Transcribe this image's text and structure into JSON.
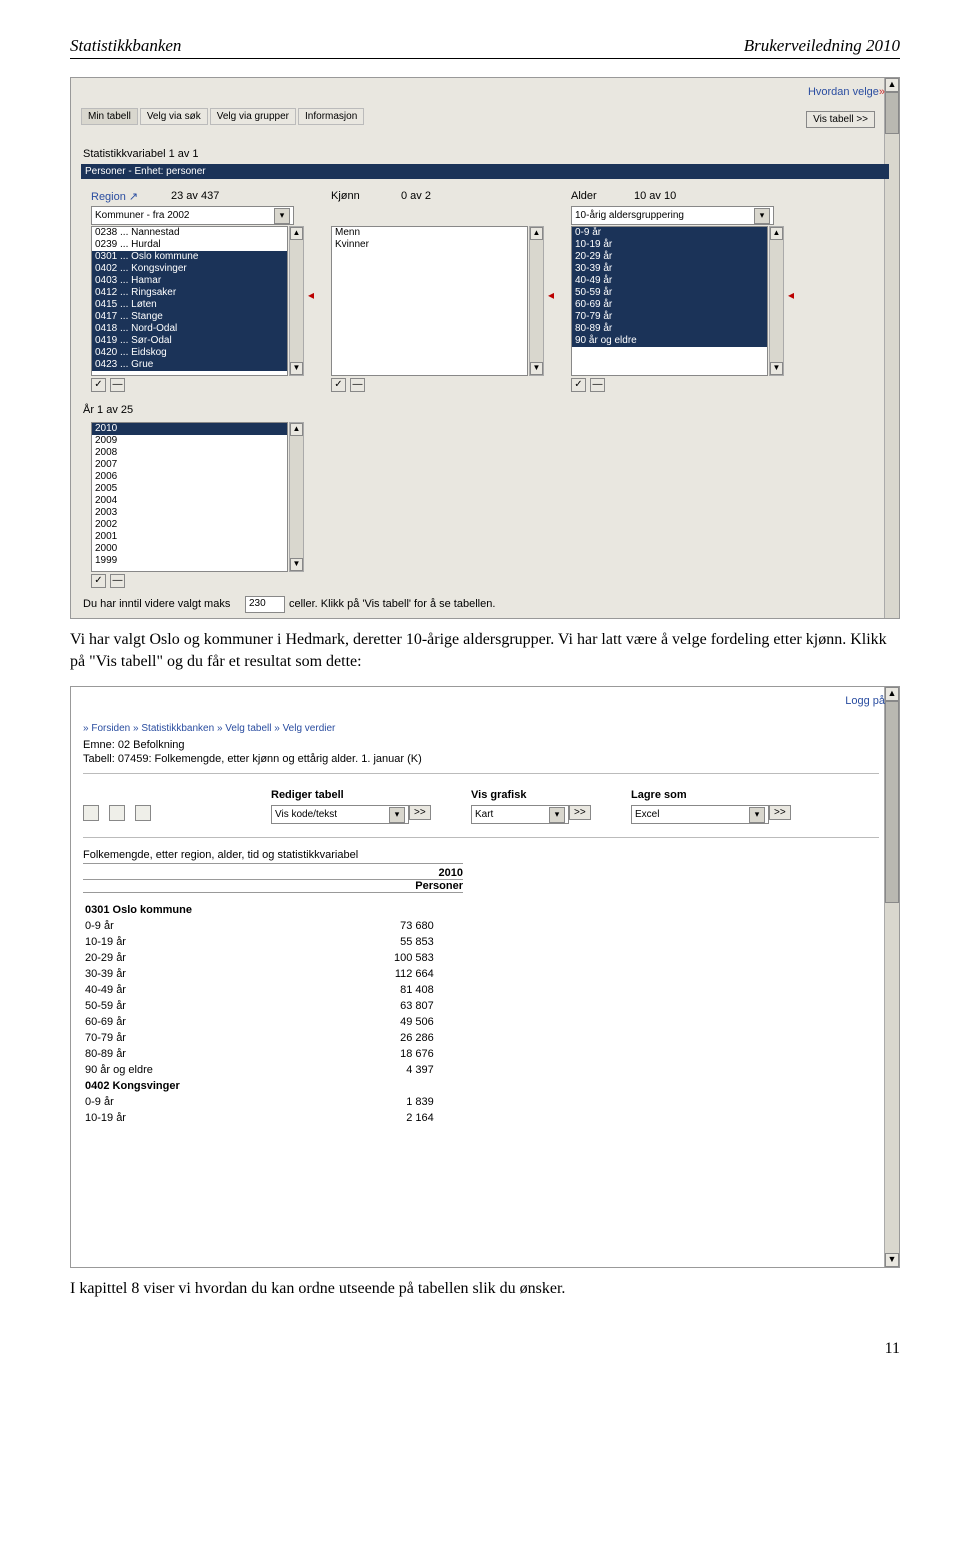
{
  "header": {
    "left": "Statistikkbanken",
    "right": "Brukerveiledning 2010"
  },
  "para1": "Vi har valgt Oslo og kommuner i Hedmark, deretter 10-årige aldersgrupper. Vi har latt være å velge fordeling etter kjønn. Klikk på \"Vis tabell\" og du får et resultat som dette:",
  "para2": "I kapittel 8 viser vi hvordan du kan ordne utseende på tabellen slik du ønsker.",
  "pagenum": "11",
  "s1": {
    "hvordan": "Hvordan velge",
    "tabs": [
      "Min tabell",
      "Velg via søk",
      "Velg via grupper",
      "Informasjon"
    ],
    "vis": "Vis tabell >>",
    "statvar": "Statistikkvariabel        1  av  1",
    "hb": "Personer   - Enhet: personer",
    "region": "Region",
    "region_ext": "↗",
    "region_count": "23  av  437",
    "region_dd": "Kommuner - fra 2002",
    "region_items": [
      {
        "t": "0238 ... Nannestad",
        "s": false
      },
      {
        "t": "0239 ... Hurdal",
        "s": false
      },
      {
        "t": "0301 ... Oslo kommune",
        "s": true
      },
      {
        "t": "0402 ... Kongsvinger",
        "s": true
      },
      {
        "t": "0403 ... Hamar",
        "s": true
      },
      {
        "t": "0412 ... Ringsaker",
        "s": true
      },
      {
        "t": "0415 ... Løten",
        "s": true
      },
      {
        "t": "0417 ... Stange",
        "s": true
      },
      {
        "t": "0418 ... Nord-Odal",
        "s": true
      },
      {
        "t": "0419 ... Sør-Odal",
        "s": true
      },
      {
        "t": "0420 ... Eidskog",
        "s": true
      },
      {
        "t": "0423 ... Grue",
        "s": true
      }
    ],
    "kjonn": "Kjønn",
    "kjonn_count": "0  av  2",
    "kjonn_items": [
      {
        "t": "Menn",
        "s": false
      },
      {
        "t": "Kvinner",
        "s": false
      }
    ],
    "alder": "Alder",
    "alder_count": "10  av  10",
    "alder_dd": "10-årig aldersgruppering",
    "alder_items": [
      {
        "t": "0-9 år",
        "s": true
      },
      {
        "t": "10-19 år",
        "s": true
      },
      {
        "t": "20-29 år",
        "s": true
      },
      {
        "t": "30-39 år",
        "s": true
      },
      {
        "t": "40-49 år",
        "s": true
      },
      {
        "t": "50-59 år",
        "s": true
      },
      {
        "t": "60-69 år",
        "s": true
      },
      {
        "t": "70-79 år",
        "s": true
      },
      {
        "t": "80-89 år",
        "s": true
      },
      {
        "t": "90 år og eldre",
        "s": true
      }
    ],
    "ar": "År         1  av 25",
    "ar_items": [
      {
        "t": "2010",
        "s": true
      },
      {
        "t": "2009",
        "s": false
      },
      {
        "t": "2008",
        "s": false
      },
      {
        "t": "2007",
        "s": false
      },
      {
        "t": "2006",
        "s": false
      },
      {
        "t": "2005",
        "s": false
      },
      {
        "t": "2004",
        "s": false
      },
      {
        "t": "2003",
        "s": false
      },
      {
        "t": "2002",
        "s": false
      },
      {
        "t": "2001",
        "s": false
      },
      {
        "t": "2000",
        "s": false
      },
      {
        "t": "1999",
        "s": false
      }
    ],
    "bottom_a": "Du har inntil videre valgt maks",
    "bottom_val": "230",
    "bottom_b": "celler. Klikk på 'Vis tabell' for å se tabellen.",
    "check": "✓",
    "dash": "—"
  },
  "s2": {
    "logg": "Logg på",
    "crumbs": "» Forsiden » Statistikkbanken » Velg tabell » Velg verdier",
    "emne": "Emne: 02 Befolkning",
    "tabell": "Tabell: 07459: Folkemengde, etter kjønn og ettårig alder. 1. januar (K)",
    "rediger": "Rediger tabell",
    "rediger_v": "Vis kode/tekst",
    "visg": "Vis grafisk",
    "visg_v": "Kart",
    "lagre": "Lagre som",
    "lagre_v": "Excel",
    "go": ">>",
    "tbltitle": "Folkemengde, etter region, alder, tid og statistikkvariabel",
    "col_year": "2010",
    "col_var": "Personer",
    "rows": [
      {
        "l": "0301 Oslo kommune",
        "v": "",
        "b": true
      },
      {
        "l": "0-9 år",
        "v": "73 680"
      },
      {
        "l": "10-19 år",
        "v": "55 853"
      },
      {
        "l": "20-29 år",
        "v": "100 583"
      },
      {
        "l": "30-39 år",
        "v": "112 664"
      },
      {
        "l": "40-49 år",
        "v": "81 408"
      },
      {
        "l": "50-59 år",
        "v": "63 807"
      },
      {
        "l": "60-69 år",
        "v": "49 506"
      },
      {
        "l": "70-79 år",
        "v": "26 286"
      },
      {
        "l": "80-89 år",
        "v": "18 676"
      },
      {
        "l": "90 år og eldre",
        "v": "4 397"
      },
      {
        "l": "0402 Kongsvinger",
        "v": "",
        "b": true
      },
      {
        "l": "0-9 år",
        "v": "1 839"
      },
      {
        "l": "10-19 år",
        "v": "2 164"
      }
    ]
  }
}
